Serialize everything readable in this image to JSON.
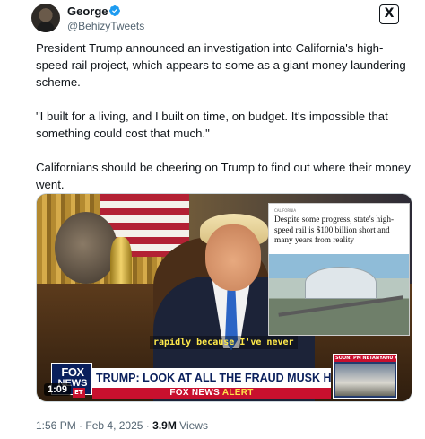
{
  "author": {
    "name": "George",
    "handle": "@BehizyTweets",
    "verified": true,
    "avatar_icon": "avatar-photo"
  },
  "platform_icon": "x-logo-icon",
  "platform_label": "X",
  "tweet": {
    "paragraphs": [
      "President Trump announced an investigation into California's high-speed rail project, which appears to some as a giant money laundering scheme.",
      "\"I built for a living, and I built on time, on budget. It's impossible that something could cost that much.\"",
      "Californians should be cheering on Trump to find out where their money went."
    ]
  },
  "media": {
    "duration": "1:09",
    "caption": "rapidly because I've never",
    "article": {
      "kicker": "CALIFORNIA",
      "headline": "Despite some progress, state's high-speed rail is $100 billion short and many years from reality"
    },
    "chyron": {
      "logo_top": "FOX",
      "logo_bottom": "NEWS",
      "headline": "TRUMP: LOOK AT ALL THE FRAUD MUSK HAS FOUND",
      "alert_brand": "FOX NEWS",
      "alert_word": "ALERT",
      "timezone": "ET",
      "soon_label": "SOON: PM NETANYAHU AT WH"
    }
  },
  "meta": {
    "time": "1:56 PM",
    "separator": "·",
    "date": "Feb 4, 2025",
    "views_count": "3.9M",
    "views_label": "Views"
  },
  "colors": {
    "verified": "#1d9bf0",
    "fox_red": "#c8102e",
    "fox_navy": "#0a1f5c",
    "muted_text": "#536471"
  }
}
